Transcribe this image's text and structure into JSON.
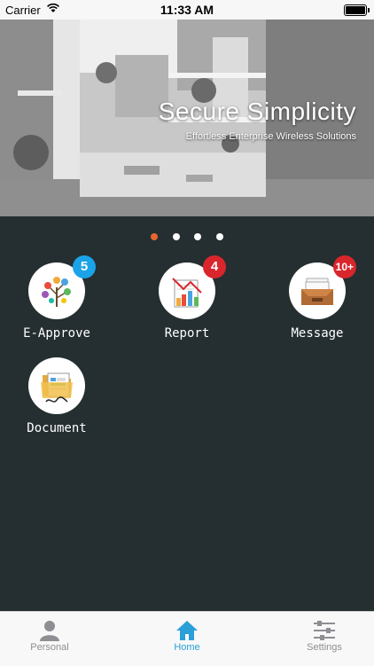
{
  "status_bar": {
    "carrier": "Carrier",
    "time": "11:33 AM"
  },
  "banner": {
    "headline": "Secure Simplicity",
    "tagline": "Effortless Enterprise Wireless Solutions"
  },
  "pager": {
    "count": 4,
    "active_index": 0,
    "active_color": "#e8662d"
  },
  "tiles": [
    {
      "label": "E-Approve",
      "badge": "5",
      "badge_color": "#1aa3e8",
      "icon": "e-approve-icon"
    },
    {
      "label": "Report",
      "badge": "4",
      "badge_color": "#d9262c",
      "icon": "report-chart-icon"
    },
    {
      "label": "Message",
      "badge": "10+",
      "badge_color": "#d9262c",
      "icon": "message-inbox-icon"
    },
    {
      "label": "Document",
      "badge": "",
      "badge_color": "",
      "icon": "document-folder-icon"
    }
  ],
  "tabbar": {
    "active_color": "#2a9fd8",
    "tabs": [
      {
        "label": "Personal",
        "icon": "person-icon",
        "active": false
      },
      {
        "label": "Home",
        "icon": "home-icon",
        "active": true
      },
      {
        "label": "Settings",
        "icon": "settings-sliders-icon",
        "active": false
      }
    ]
  }
}
